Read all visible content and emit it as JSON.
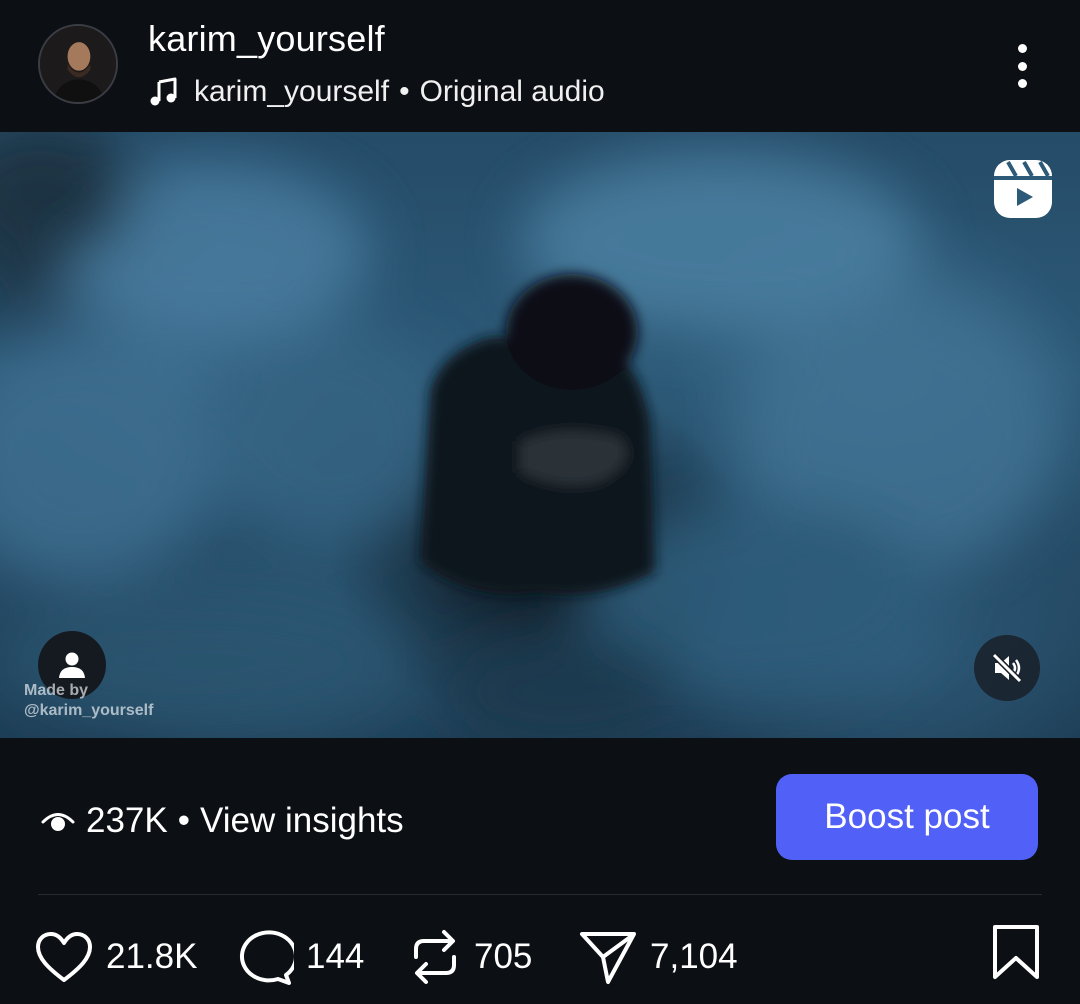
{
  "header": {
    "username": "karim_yourself",
    "audio_artist": "karim_yourself",
    "audio_separator": "•",
    "audio_label": "Original audio"
  },
  "video": {
    "watermark_line1": "Made by",
    "watermark_line2": "@karim_yourself",
    "muted": true
  },
  "insights": {
    "views": "237K",
    "separator": "•",
    "link_label": "View insights",
    "boost_label": "Boost post"
  },
  "actions": {
    "likes": "21.8K",
    "comments": "144",
    "reposts": "705",
    "shares": "7,104"
  },
  "colors": {
    "background": "#0c0f14",
    "boost_button": "#5161f8",
    "text": "#ffffff"
  },
  "icons": [
    "music-icon",
    "more-icon",
    "reels-icon",
    "user-icon",
    "mute-icon",
    "eye-icon",
    "heart-icon",
    "comment-icon",
    "repost-icon",
    "send-icon",
    "bookmark-icon"
  ]
}
